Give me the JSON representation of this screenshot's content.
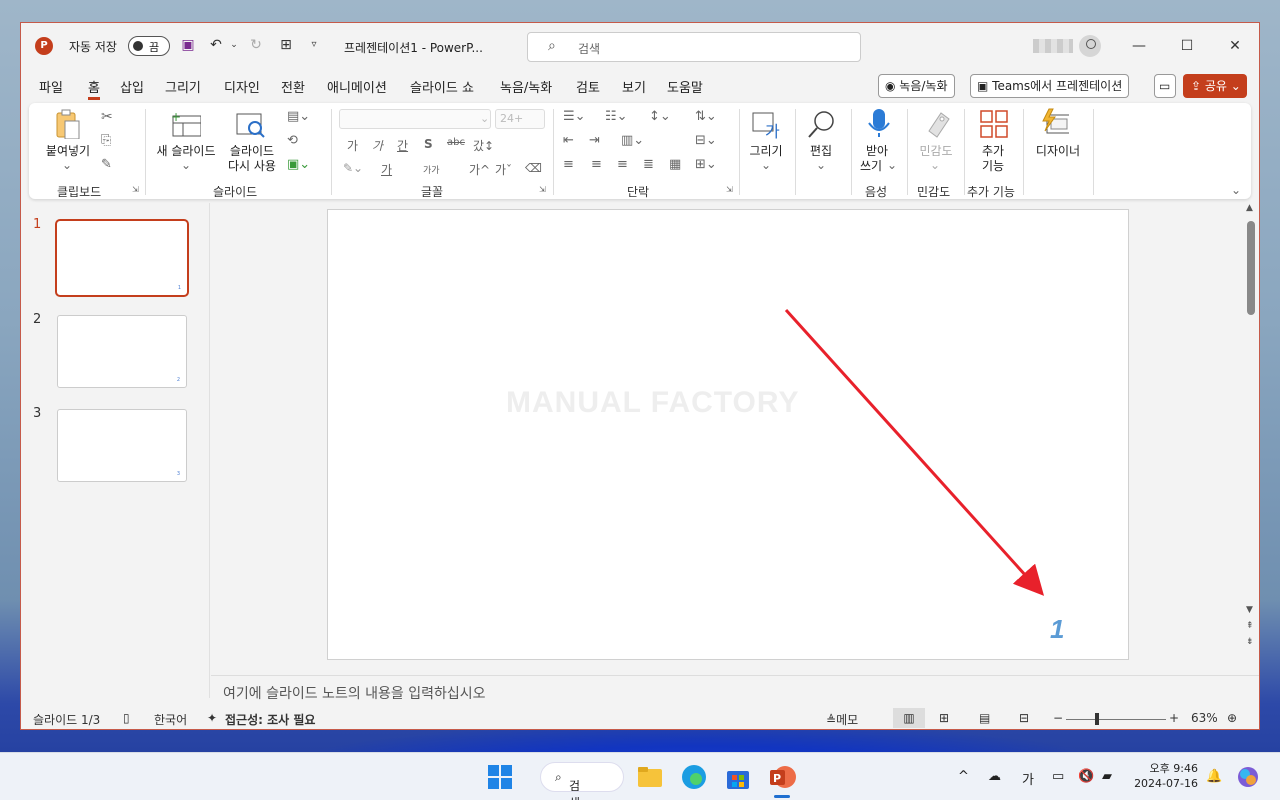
{
  "app": {
    "autosave_label": "자동 저장",
    "autosave_state": "끔",
    "doc_title": "프레젠테이션1  -  PowerP...",
    "search_placeholder": "검색"
  },
  "menu": {
    "tabs": [
      "파일",
      "홈",
      "삽입",
      "그리기",
      "디자인",
      "전환",
      "애니메이션",
      "슬라이드 쇼",
      "녹음/녹화",
      "검토",
      "보기",
      "도움말"
    ],
    "active_tab": "홈",
    "record_button": "녹음/녹화",
    "teams_button": "Teams에서 프레젠테이션",
    "share_button": "공유"
  },
  "ribbon": {
    "paste": "붙여넣기",
    "clipboard_group": "클립보드",
    "new_slide": "새 슬라이드",
    "reuse_slide_1": "슬라이드",
    "reuse_slide_2": "다시 사용",
    "slides_group": "슬라이드",
    "font_size": "24+",
    "font_group": "글꼴",
    "paragraph_group": "단락",
    "draw": "그리기",
    "edit": "편집",
    "dictate_1": "받아",
    "dictate_2": "쓰기",
    "voice_group": "음성",
    "sensitivity": "민감도",
    "sensitivity_group": "민감도",
    "addins_1": "추가",
    "addins_2": "기능",
    "addins_group": "추가 기능",
    "designer": "디자이너",
    "font_buttons": [
      "가",
      "가",
      "간",
      "S",
      "abc",
      "갔↕"
    ],
    "font_row3": [
      "가",
      "가가",
      "가^",
      "가ˇ"
    ]
  },
  "thumbnails": [
    {
      "num": "1",
      "selected": true
    },
    {
      "num": "2",
      "selected": false
    },
    {
      "num": "3",
      "selected": false
    }
  ],
  "slide": {
    "watermark": "MANUAL FACTORY",
    "page_number": "1"
  },
  "notes_placeholder": "여기에 슬라이드 노트의 내용을 입력하십시오",
  "status": {
    "slide_info": "슬라이드 1/3",
    "language": "한국어",
    "accessibility": "접근성: 조사 필요",
    "memo": "메모",
    "zoom": "63%",
    "zoom_level": 0.3
  },
  "taskbar": {
    "search": "검색",
    "ime": "가",
    "time": "오후 9:46",
    "date": "2024-07-16"
  },
  "colors": {
    "accent": "#c43e1c",
    "arrow": "#e8212b",
    "slide_number": "#5b9bd5"
  }
}
